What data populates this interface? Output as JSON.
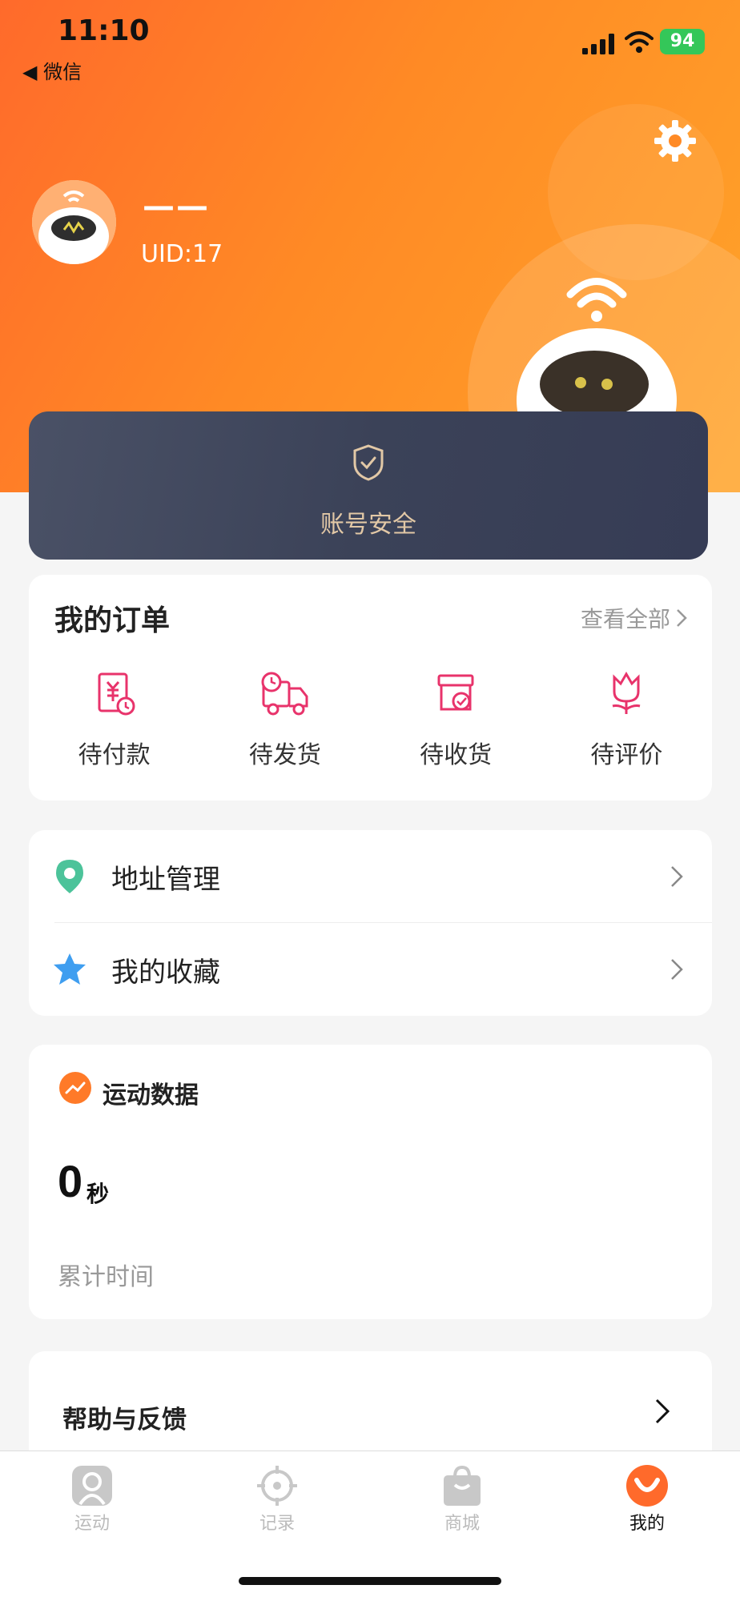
{
  "status_bar": {
    "time": "11:10",
    "back_app": "◀ 微信",
    "battery": "94"
  },
  "profile": {
    "username": "——",
    "uid": "UID:17"
  },
  "security": {
    "label": "账号安全"
  },
  "orders": {
    "title": "我的订单",
    "view_all": "查看全部",
    "items": [
      {
        "label": "待付款",
        "icon": "pending-payment-icon"
      },
      {
        "label": "待发货",
        "icon": "pending-shipment-icon"
      },
      {
        "label": "待收货",
        "icon": "pending-receipt-icon"
      },
      {
        "label": "待评价",
        "icon": "pending-review-icon"
      }
    ]
  },
  "menu": {
    "items": [
      {
        "label": "地址管理",
        "icon": "location-pin-icon"
      },
      {
        "label": "我的收藏",
        "icon": "star-icon"
      }
    ]
  },
  "sport": {
    "title": "运动数据",
    "value": "0",
    "unit": "秒",
    "caption": "累计时间"
  },
  "help": {
    "label": "帮助与反馈"
  },
  "tabbar": {
    "items": [
      {
        "label": "运动",
        "icon": "sport-icon"
      },
      {
        "label": "记录",
        "icon": "record-icon"
      },
      {
        "label": "商城",
        "icon": "shop-icon"
      },
      {
        "label": "我的",
        "icon": "profile-icon",
        "active": true
      }
    ]
  },
  "colors": {
    "accent": "#ff7a28",
    "order_icon": "#e8336b",
    "security_bg": "#3b4258",
    "security_text": "#e2c8a6"
  }
}
